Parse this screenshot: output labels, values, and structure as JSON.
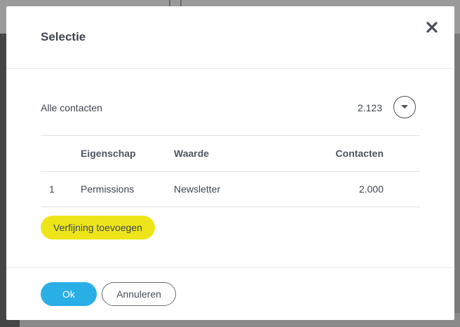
{
  "dialog": {
    "title": "Selectie",
    "close_icon": "close-icon"
  },
  "summary": {
    "label": "Alle contacten",
    "count": "2.123",
    "dropdown_icon": "caret-down-icon"
  },
  "table": {
    "headers": {
      "index": "",
      "property": "Eigenschap",
      "value": "Waarde",
      "contacts": "Contacten"
    },
    "rows": [
      {
        "index": "1",
        "property": "Permissions",
        "value": "Newsletter",
        "contacts": "2.000"
      }
    ]
  },
  "refine_button": {
    "label": "Verfijning toevoegen",
    "color": "#ede51a"
  },
  "footer": {
    "ok_label": "Ok",
    "cancel_label": "Annuleren",
    "ok_color": "#2aaee6"
  }
}
